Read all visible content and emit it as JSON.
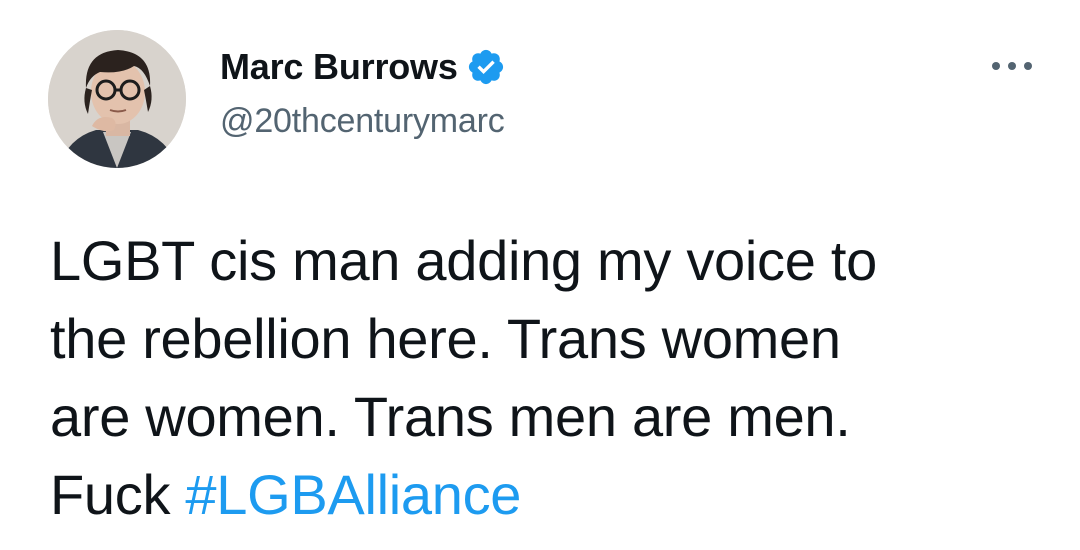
{
  "author": {
    "display_name": "Marc Burrows",
    "handle": "@20thcenturymarc",
    "verified": true,
    "verified_color": "#1d9bf0"
  },
  "menu": {
    "icon": "more-horizontal-icon"
  },
  "tweet": {
    "lines": [
      "LGBT cis man adding my voice to",
      "the rebellion here. Trans women",
      "are women. Trans men are men."
    ],
    "last_line_prefix": "Fuck ",
    "hashtag": "#LGBAlliance",
    "hashtag_color": "#1d9bf0"
  }
}
